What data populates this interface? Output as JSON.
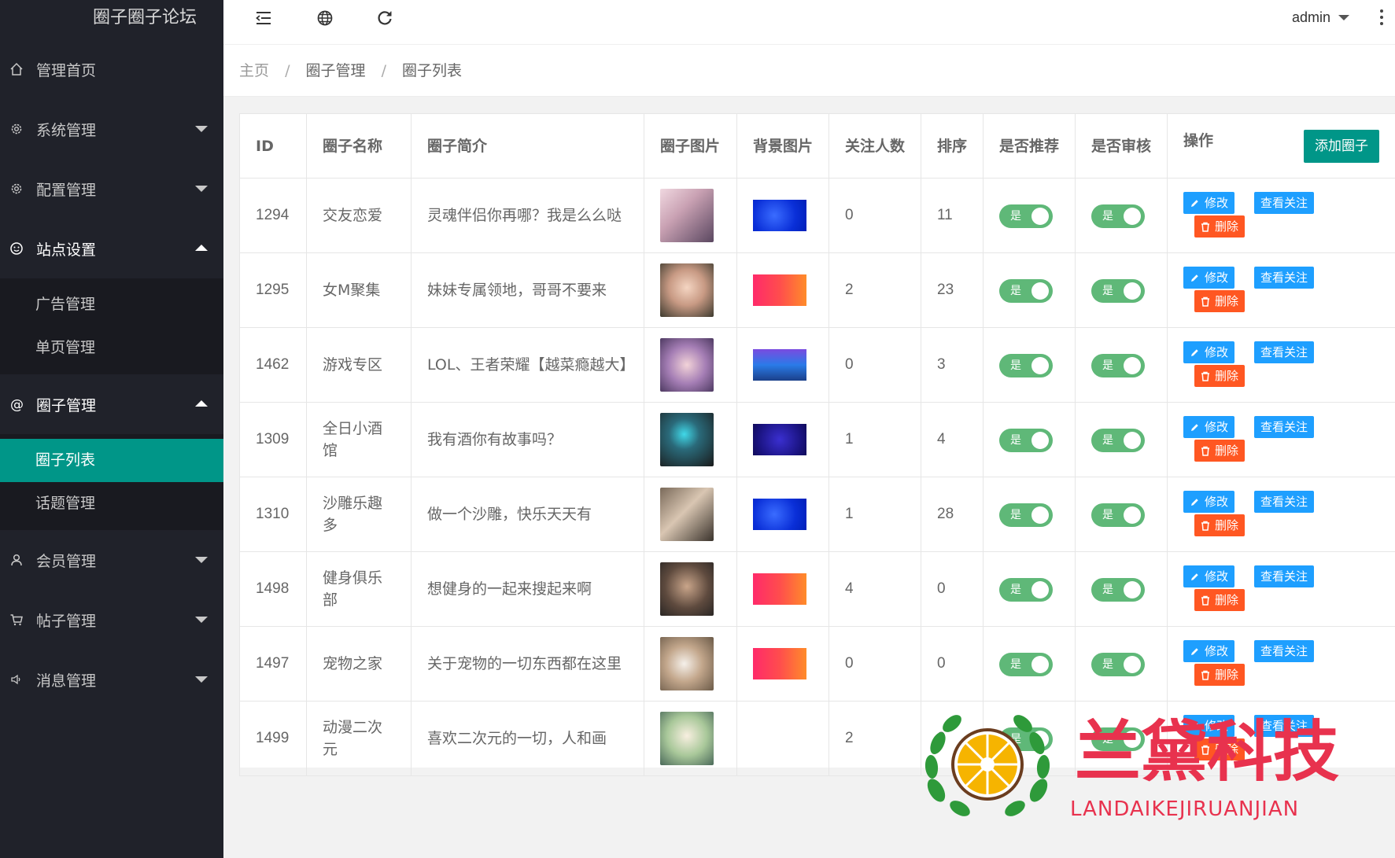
{
  "app": {
    "title": "圈子圈子论坛"
  },
  "sidebar": {
    "items": [
      {
        "label": "管理首页",
        "icon": "home-icon",
        "expandable": false
      },
      {
        "label": "系统管理",
        "icon": "gear-icon",
        "expandable": true
      },
      {
        "label": "配置管理",
        "icon": "gear-icon",
        "expandable": true
      },
      {
        "label": "站点设置",
        "icon": "smile-icon",
        "expandable": true,
        "open": true,
        "children": [
          "广告管理",
          "单页管理"
        ]
      },
      {
        "label": "圈子管理",
        "icon": "at-icon",
        "expandable": true,
        "open": true,
        "children": [
          "圈子列表",
          "话题管理"
        ],
        "active_child": "圈子列表"
      },
      {
        "label": "会员管理",
        "icon": "user-icon",
        "expandable": true
      },
      {
        "label": "帖子管理",
        "icon": "cart-icon",
        "expandable": true
      },
      {
        "label": "消息管理",
        "icon": "speaker-icon",
        "expandable": true
      }
    ]
  },
  "header": {
    "user": "admin",
    "icons": [
      "menu-shrink-icon",
      "globe-icon",
      "refresh-icon",
      "more-vertical-icon"
    ]
  },
  "breadcrumb": {
    "items": [
      "主页",
      "圈子管理",
      "圈子列表"
    ],
    "separator": "/"
  },
  "table": {
    "columns": [
      "ID",
      "圈子名称",
      "圈子简介",
      "圈子图片",
      "背景图片",
      "关注人数",
      "排序",
      "是否推荐",
      "是否审核",
      "操作"
    ],
    "add_button": "添加圈子",
    "switch_label": "是",
    "actions": {
      "edit": "修改",
      "follow": "查看关注",
      "delete": "删除"
    },
    "rows": [
      {
        "id": "1294",
        "name": "交友恋爱",
        "intro": "灵魂伴侣你再哪？我是么么哒",
        "followers": "0",
        "sort": "11",
        "bg": "blue"
      },
      {
        "id": "1295",
        "name": "女M聚集",
        "intro": "妹妹专属领地，哥哥不要来",
        "followers": "2",
        "sort": "23",
        "bg": "red"
      },
      {
        "id": "1462",
        "name": "游戏专区",
        "intro": "LOL、王者荣耀【越菜瘾越大】",
        "followers": "0",
        "sort": "3",
        "bg": "game"
      },
      {
        "id": "1309",
        "name": "全日小酒馆",
        "intro": "我有酒你有故事吗？",
        "followers": "1",
        "sort": "4",
        "bg": "purple"
      },
      {
        "id": "1310",
        "name": "沙雕乐趣多",
        "intro": "做一个沙雕，快乐天天有",
        "followers": "1",
        "sort": "28",
        "bg": "blue"
      },
      {
        "id": "1498",
        "name": "健身俱乐部",
        "intro": "想健身的一起来搜起来啊",
        "followers": "4",
        "sort": "0",
        "bg": "red"
      },
      {
        "id": "1497",
        "name": "宠物之家",
        "intro": "关于宠物的一切东西都在这里",
        "followers": "0",
        "sort": "0",
        "bg": "red"
      },
      {
        "id": "1499",
        "name": "动漫二次元",
        "intro": "喜欢二次元的一切，人和画",
        "followers": "2",
        "sort": "0",
        "bg": "none"
      }
    ]
  },
  "watermark": {
    "title": "兰黛科技",
    "subtitle": "LANDAIKEJIRUANJIAN"
  },
  "colors": {
    "sidebar_bg": "#20222a",
    "accent": "#009688",
    "switch_on": "#5fb878",
    "edit": "#1e9fff",
    "delete": "#ff5722",
    "watermark": "#e8324e"
  }
}
